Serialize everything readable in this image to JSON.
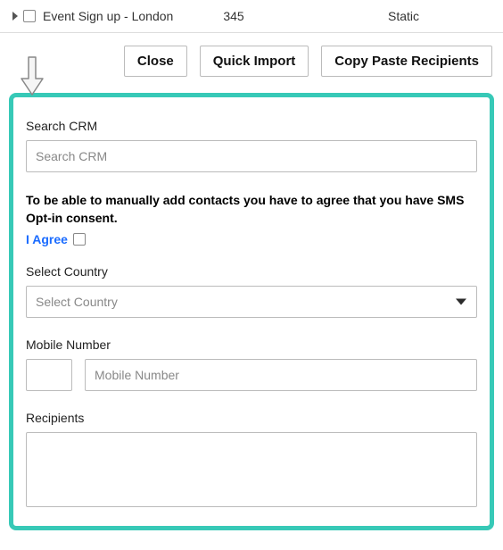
{
  "list_row": {
    "name": "Event Sign up - London",
    "count": "345",
    "type": "Static"
  },
  "buttons": {
    "close": "Close",
    "quick_import": "Quick Import",
    "copy_paste": "Copy Paste Recipients"
  },
  "panel": {
    "search_crm": {
      "label": "Search CRM",
      "placeholder": "Search CRM",
      "value": ""
    },
    "consent": {
      "text": "To be able to manually add contacts you have to agree that you have SMS Opt-in consent.",
      "agree_label": "I Agree"
    },
    "country": {
      "label": "Select Country",
      "placeholder": "Select Country",
      "value": ""
    },
    "mobile": {
      "label": "Mobile Number",
      "prefix_value": "",
      "placeholder": "Mobile Number",
      "value": ""
    },
    "recipients": {
      "label": "Recipients",
      "value": ""
    }
  }
}
